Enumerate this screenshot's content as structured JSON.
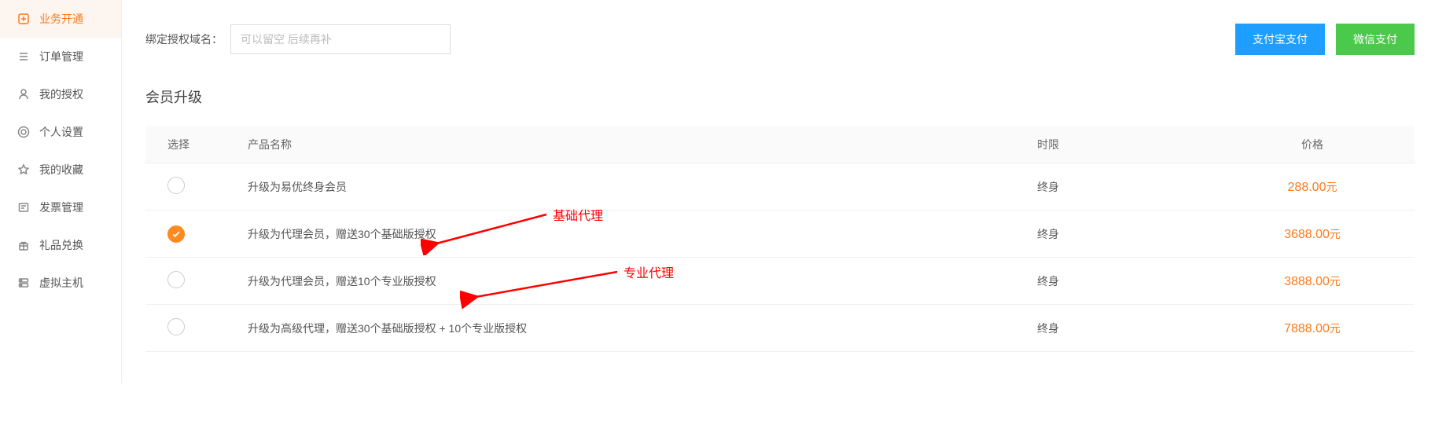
{
  "sidebar": {
    "items": [
      {
        "label": "业务开通",
        "icon": "business-open-icon",
        "active": true
      },
      {
        "label": "订单管理",
        "icon": "order-icon",
        "active": false
      },
      {
        "label": "我的授权",
        "icon": "auth-icon",
        "active": false
      },
      {
        "label": "个人设置",
        "icon": "settings-icon",
        "active": false
      },
      {
        "label": "我的收藏",
        "icon": "favorite-icon",
        "active": false
      },
      {
        "label": "发票管理",
        "icon": "invoice-icon",
        "active": false
      },
      {
        "label": "礼品兑换",
        "icon": "gift-icon",
        "active": false
      },
      {
        "label": "虚拟主机",
        "icon": "host-icon",
        "active": false
      }
    ]
  },
  "top": {
    "domain_label": "绑定授权域名：",
    "domain_placeholder": "可以留空 后续再补",
    "domain_value": "",
    "alipay_btn": "支付宝支付",
    "wechat_btn": "微信支付"
  },
  "section_title": "会员升级",
  "table": {
    "headers": {
      "select": "选择",
      "name": "产品名称",
      "limit": "时限",
      "price": "价格"
    },
    "rows": [
      {
        "selected": false,
        "name": "升级为易优终身会员",
        "limit": "终身",
        "price": "288.00",
        "unit": "元"
      },
      {
        "selected": true,
        "name": "升级为代理会员，赠送30个基础版授权",
        "limit": "终身",
        "price": "3688.00",
        "unit": "元"
      },
      {
        "selected": false,
        "name": "升级为代理会员，赠送10个专业版授权",
        "limit": "终身",
        "price": "3888.00",
        "unit": "元"
      },
      {
        "selected": false,
        "name": "升级为高级代理，赠送30个基础版授权 + 10个专业版授权",
        "limit": "终身",
        "price": "7888.00",
        "unit": "元"
      }
    ]
  },
  "annotations": {
    "basic": "基础代理",
    "pro": "专业代理"
  }
}
